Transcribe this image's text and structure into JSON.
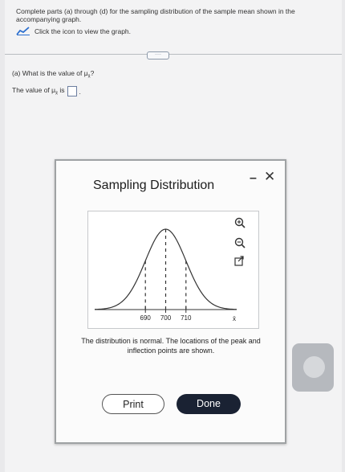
{
  "intro": "Complete parts (a) through (d) for the sampling distribution of the sample mean shown in the accompanying graph.",
  "graph_link": {
    "label": "Click the icon to view the graph."
  },
  "more": {
    "label": "····"
  },
  "question_a": {
    "prompt_prefix": "(a) What is the value of μ",
    "subscript": "x̄",
    "prompt_suffix": "?",
    "answer_prefix": "The value of μ",
    "answer_mid": " is",
    "answer_end": "."
  },
  "dialog": {
    "title": "Sampling Distribution",
    "minimize": "–",
    "close": "✕",
    "caption": "The distribution is normal. The locations of the peak and inflection points are shown.",
    "print_label": "Print",
    "done_label": "Done"
  },
  "chart_data": {
    "type": "line",
    "description_none": "",
    "x_tick_labels": [
      "690",
      "700",
      "710"
    ],
    "x_ticks": [
      690,
      700,
      710
    ],
    "axis_label": "x̄",
    "curve": "normal",
    "mean": 700,
    "sd": 10,
    "xlim": [
      665,
      735
    ],
    "tool_icons": [
      "zoom-in-icon",
      "zoom-out-icon",
      "external-link-icon"
    ]
  }
}
